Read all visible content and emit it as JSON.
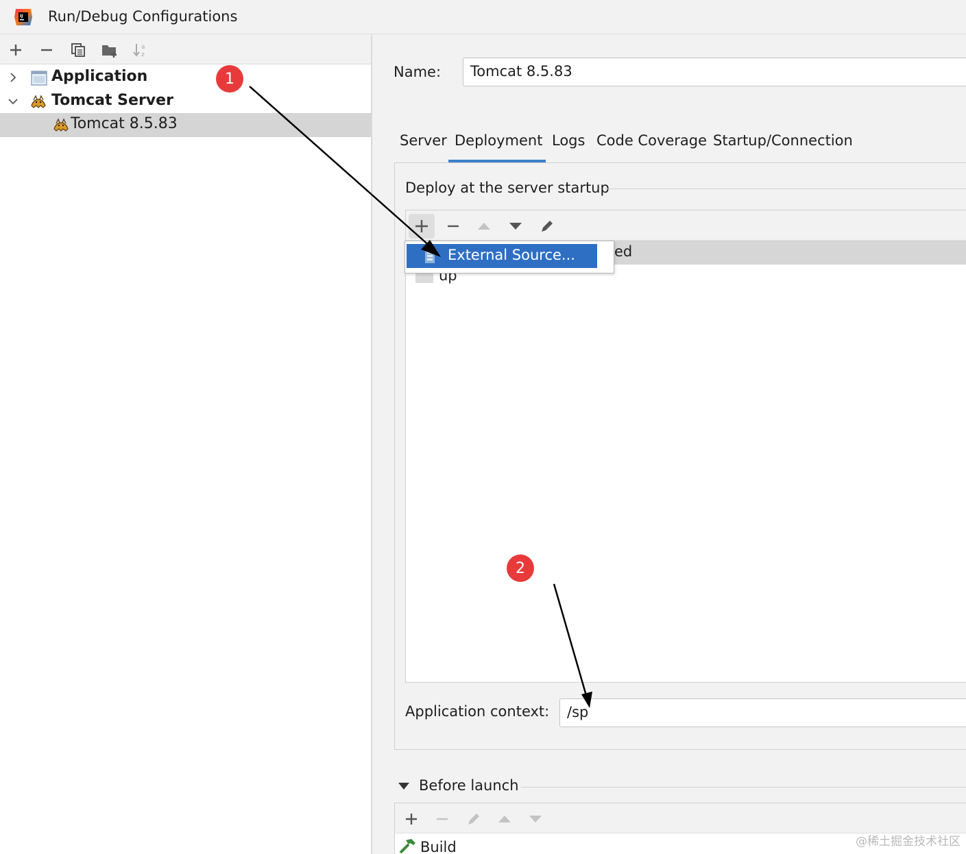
{
  "window": {
    "title": "Run/Debug Configurations"
  },
  "tree": {
    "items": [
      {
        "label": "Application",
        "expanded": false
      },
      {
        "label": "Tomcat Server",
        "expanded": true
      },
      {
        "label": "Tomcat 8.5.83",
        "selected": true
      }
    ]
  },
  "form": {
    "name_label": "Name:",
    "name_value": "Tomcat 8.5.83"
  },
  "tabs": [
    {
      "label": "Server"
    },
    {
      "label": "Deployment",
      "active": true
    },
    {
      "label": "Logs"
    },
    {
      "label": "Code Coverage"
    },
    {
      "label": "Startup/Connection"
    }
  ],
  "deployment": {
    "section_title": "Deploy at the server startup",
    "partial_row_text": "ed",
    "partial_row2_text": "up",
    "context_label": "Application context:",
    "context_value": "/sp"
  },
  "popup": {
    "item_label": "External Source..."
  },
  "before_launch": {
    "title": "Before launch",
    "item_label": "Build"
  },
  "annotations": {
    "badge1": "1",
    "badge2": "2"
  },
  "watermark": "@稀土掘金技术社区",
  "colors": {
    "accent": "#3d7fc8",
    "popup_highlight": "#2e6fc4",
    "badge": "#e83a3a"
  }
}
